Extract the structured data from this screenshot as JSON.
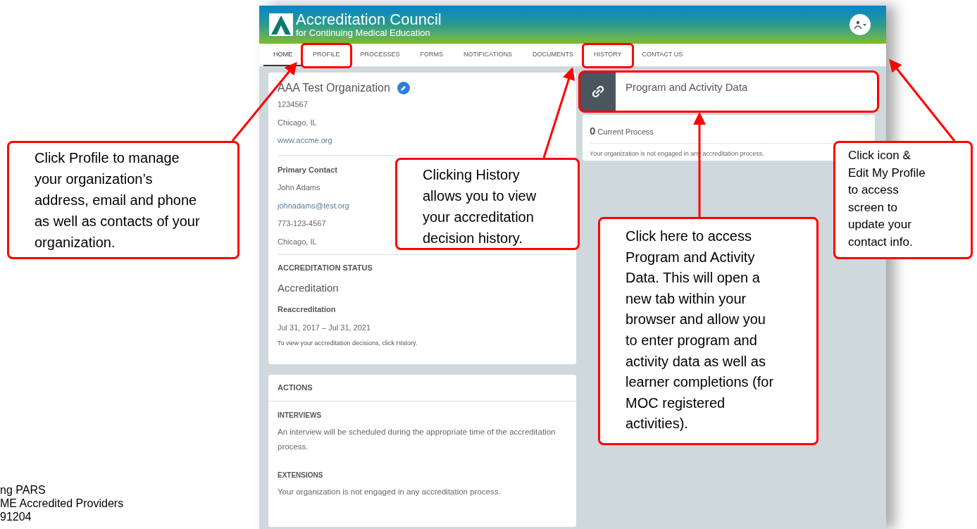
{
  "header": {
    "logo_title": "Accreditation Council",
    "logo_subtitle": "for Continuing Medical Education"
  },
  "nav_tabs": [
    {
      "label": "HOME",
      "selected": true,
      "highlighted": false
    },
    {
      "label": "PROFILE",
      "selected": false,
      "highlighted": true
    },
    {
      "label": "PROCESSES",
      "selected": false,
      "highlighted": false
    },
    {
      "label": "FORMS",
      "selected": false,
      "highlighted": false
    },
    {
      "label": "NOTIFICATIONS",
      "selected": false,
      "highlighted": false
    },
    {
      "label": "DOCUMENTS",
      "selected": false,
      "highlighted": false
    },
    {
      "label": "HISTORY",
      "selected": false,
      "highlighted": true
    },
    {
      "label": "CONTACT US",
      "selected": false,
      "highlighted": false
    }
  ],
  "organization_card": {
    "name": "AAA Test Organization",
    "id": "1234567",
    "location": "Chicago, IL",
    "website": "www.accme.org",
    "contact_heading": "Primary Contact",
    "contact_name": "John Adams",
    "contact_email": "johnadams@test.org",
    "contact_phone": "773-123-4567",
    "contact_location": "Chicago, IL",
    "status_heading": "ACCREDITATION STATUS",
    "status": "Accreditation",
    "status_type": "Reaccreditation",
    "status_dates": "Jul 31, 2017 – Jul 31, 2021",
    "status_note": "To view your accreditation decisions, click History."
  },
  "actions_card": {
    "title": "ACTIONS",
    "sections": [
      {
        "heading": "INTERVIEWS",
        "text": "An interview will be scheduled during the appropriate time of the accreditation process."
      },
      {
        "heading": "EXTENSIONS",
        "text": "Your organization is not engaged in any accreditation process."
      }
    ]
  },
  "program_card": {
    "title": "Program and Activity Data",
    "highlighted": true
  },
  "current_process": {
    "count": "0",
    "label": "Current Process",
    "message": "Your organization is not engaged in any accreditation process."
  },
  "callouts": [
    {
      "text": "Click Profile to manage\nyour organization’s\naddress, email and phone\nas well as contacts of your\norganization."
    },
    {
      "text": "Clicking History\nallows you to view\nyour accreditation\ndecision history."
    },
    {
      "text": "Click here to access\nProgram and Activity\nData. This will open a\nnew tab within your\nbrowser and allow you\nto enter program and\nactivity data as well as\nlearner completions (for\nMOC registered\nactivities)."
    },
    {
      "text": "Click icon &\nEdit My Profile\nto access\nscreen to\nupdate your\ncontact info."
    }
  ],
  "document_footer": {
    "lines": [
      "ng PARS",
      "ME Accredited Providers",
      "91204"
    ]
  }
}
